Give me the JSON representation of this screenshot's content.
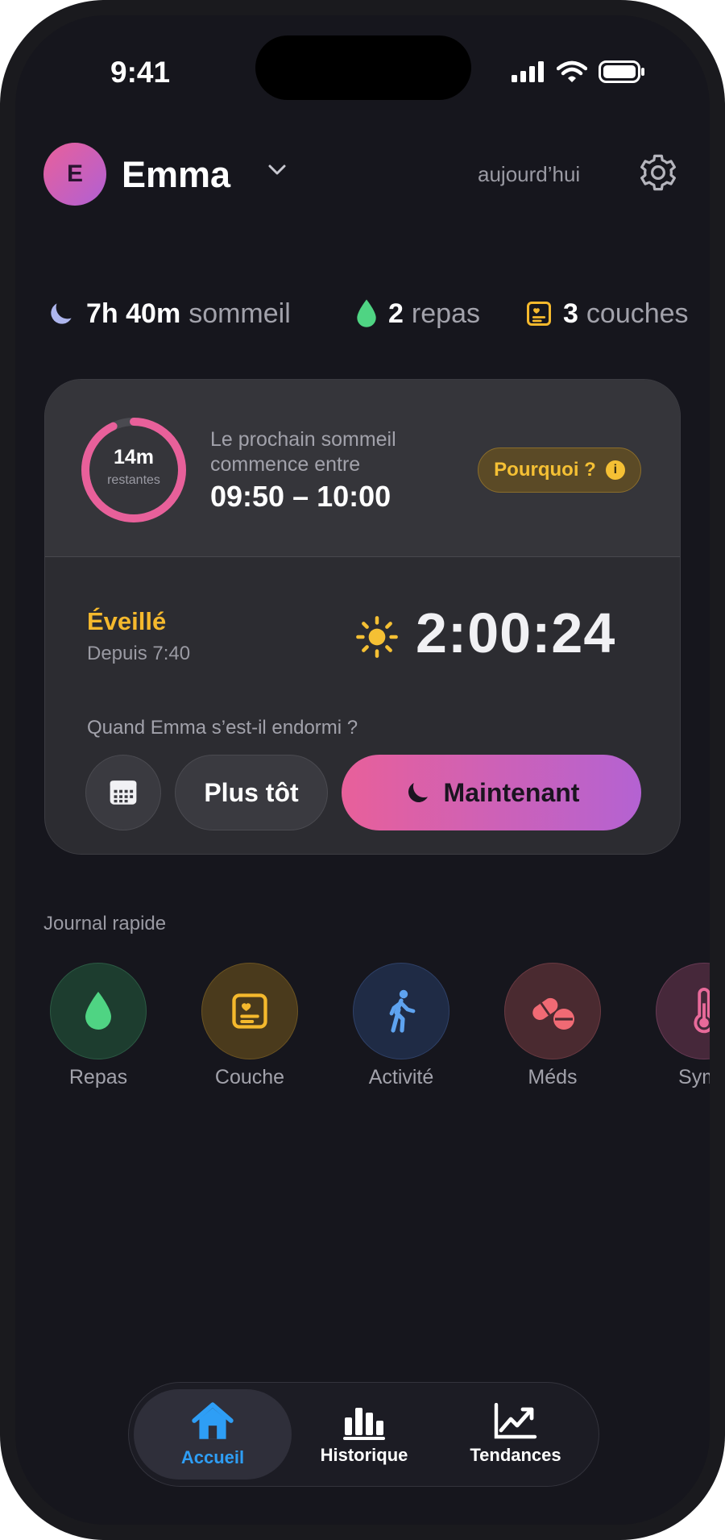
{
  "status": {
    "time": "9:41"
  },
  "header": {
    "avatar_initial": "E",
    "child_name": "Emma",
    "date_label": "aujourd’hui"
  },
  "summary": [
    {
      "value": "7h 40m",
      "label": "sommeil",
      "icon": "moon-icon"
    },
    {
      "value": "2",
      "label": "repas",
      "icon": "drop-icon"
    },
    {
      "value": "3",
      "label": "couches",
      "icon": "diaper-icon"
    }
  ],
  "next_sleep": {
    "remaining_value": "14m",
    "remaining_label": "restantes",
    "remaining_fraction": 0.93,
    "line1": "Le prochain sommeil",
    "line2": "commence entre",
    "window": "09:50 – 10:00",
    "why_label": "Pourquoi ?",
    "info_glyph": "i"
  },
  "state": {
    "title": "Éveillé",
    "since": "Depuis 7:40",
    "timer": "2:00:24",
    "question": "Quand Emma s’est-il endormi ?",
    "earlier_label": "Plus tôt",
    "now_label": "Maintenant"
  },
  "quick_log": {
    "title": "Journal rapide",
    "items": [
      {
        "label": "Repas",
        "icon": "drop-icon"
      },
      {
        "label": "Couche",
        "icon": "diaper-icon"
      },
      {
        "label": "Activité",
        "icon": "walk-icon"
      },
      {
        "label": "Méds",
        "icon": "pills-icon"
      },
      {
        "label": "Symp",
        "icon": "thermometer-icon"
      }
    ]
  },
  "tabs": [
    {
      "label": "Accueil",
      "icon": "home-icon",
      "active": true
    },
    {
      "label": "Historique",
      "icon": "bar-chart-icon",
      "active": false
    },
    {
      "label": "Tendances",
      "icon": "trend-icon",
      "active": false
    }
  ],
  "colors": {
    "accent_pink": "#e8609a",
    "accent_purple": "#b462d2",
    "awake_amber": "#f5b92d",
    "feed_green": "#4fd483",
    "active_tab_blue": "#2e9ef5"
  }
}
